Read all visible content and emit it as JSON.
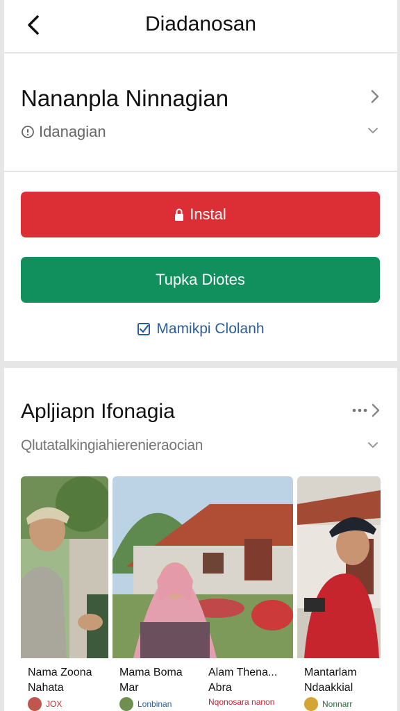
{
  "topbar": {
    "title": "Diadanosan"
  },
  "app": {
    "name": "Nananpla Ninnagian",
    "subtitle": "Idanagian"
  },
  "actions": {
    "install_label": "Instal",
    "open_label": "Tupka Diotes",
    "link_label": "Mamikpi Clolanh"
  },
  "section": {
    "title": "Apljiapn Ifonagia",
    "subtitle": "Qlutatalkingiahierenieraocian"
  },
  "shots": [
    {
      "line1": "Nama Zoona",
      "line2": "Nahata",
      "meta": "JOX"
    },
    {
      "line1": "Mama Boma",
      "line2": "Mar",
      "meta": "Lonbinan"
    },
    {
      "line1": "Alam Thena...",
      "line2": "Abra",
      "meta": "Nqonosara nanon"
    },
    {
      "line1": "Mantarlam",
      "line2": "Ndaakkial",
      "meta": "Nonnarr"
    }
  ],
  "colors": {
    "install": "#dc2f35",
    "open": "#11905e",
    "link": "#2a5d9a"
  },
  "icons": [
    "back-icon",
    "chevron-right-icon",
    "info-icon",
    "chevron-down-icon",
    "lock-icon",
    "checkbox-icon",
    "more-icon"
  ]
}
